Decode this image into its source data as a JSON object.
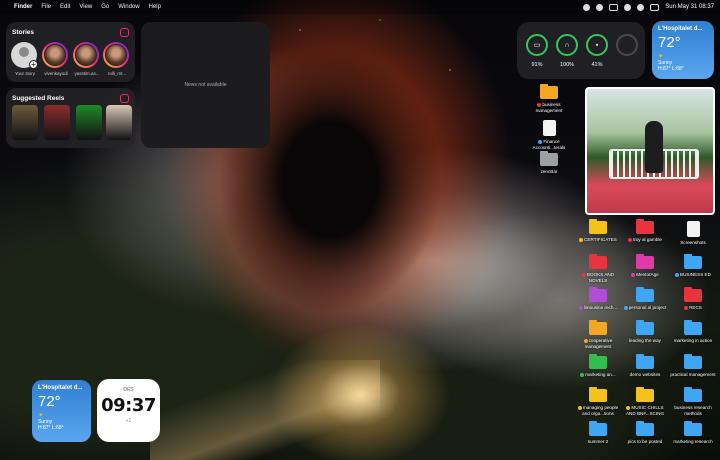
{
  "menubar": {
    "apple_glyph": "",
    "app_name": "Finder",
    "items": [
      "File",
      "Edit",
      "View",
      "Go",
      "Window",
      "Help"
    ],
    "datetime": "Sun May 31 08:37"
  },
  "stories_widget": {
    "title": "Stories",
    "stories": [
      {
        "label": "Your story"
      },
      {
        "label": "vivenkayodi"
      },
      {
        "label": "yasstim.as..."
      },
      {
        "label": "rolli_mt..."
      }
    ]
  },
  "reels_widget": {
    "title": "Suggested Reels",
    "reels": [
      {
        "color": "#6b5a3e"
      },
      {
        "color": "#8a2e2e"
      },
      {
        "color": "#1f8a2a"
      },
      {
        "color": "#d9c9b8"
      }
    ]
  },
  "news_widget": {
    "message": "News not available"
  },
  "battery_widget": {
    "items": [
      {
        "icon": "laptop-icon",
        "percent": "91%",
        "level": 0.91
      },
      {
        "icon": "airpods-icon",
        "percent": "100%",
        "level": 1.0
      },
      {
        "icon": "airpods-case-icon",
        "percent": "41%",
        "level": 0.41
      },
      {
        "icon": "empty-slot",
        "percent": "",
        "level": 0
      }
    ]
  },
  "weather_top": {
    "city": "L'Hospitalet d...",
    "temp": "72°",
    "condition": "Sunny",
    "hilo": "H:87° L:68°"
  },
  "weather_bottom": {
    "city": "L'Hospitalet d...",
    "temp": "72°",
    "condition": "Sunny",
    "hilo": "H:87° L:68°"
  },
  "clock_widget": {
    "day": "DES",
    "time": "09:37",
    "offset": "+1"
  },
  "desktop": {
    "top_items": [
      {
        "label": "business management",
        "color": "orange",
        "tag": "#e8343f"
      },
      {
        "label": "Finance Accounti...terals",
        "color": "doc",
        "tag": "#3fa5f5"
      },
      {
        "label": "zencBar",
        "color": "gray",
        "tag": ""
      }
    ],
    "grid": [
      [
        {
          "label": "CERTIFICATES",
          "color": "yellow",
          "tag": "#f4c21a"
        },
        {
          "label": "troy al gamble",
          "color": "red",
          "tag": "#e8343f"
        },
        {
          "label": "Screenshots",
          "color": "doc",
          "tag": ""
        }
      ],
      [
        {
          "label": "BOOKS AND NOVELS",
          "color": "red",
          "tag": "#e8343f"
        },
        {
          "label": "MentorAge",
          "color": "pink",
          "tag": "#e03aa8"
        },
        {
          "label": "BUSINESS ED",
          "color": "blue",
          "tag": "#3fa5f5"
        }
      ],
      [
        {
          "label": "limousine rech...",
          "color": "purple",
          "tag": "#b14cd4"
        },
        {
          "label": "personal al project",
          "color": "blue",
          "tag": "#3fa5f5"
        },
        {
          "label": "RECS",
          "color": "red",
          "tag": "#e8343f"
        }
      ],
      [
        {
          "label": "cooperative management",
          "color": "orange",
          "tag": "#f5a623"
        },
        {
          "label": "leading the way",
          "color": "blue",
          "tag": ""
        },
        {
          "label": "marketing in action",
          "color": "blue",
          "tag": ""
        }
      ],
      [
        {
          "label": "marketing an...",
          "color": "green",
          "tag": "#2fbf4f"
        },
        {
          "label": "demo websites",
          "color": "blue",
          "tag": ""
        },
        {
          "label": "practical management",
          "color": "blue",
          "tag": ""
        }
      ],
      [
        {
          "label": "managing people and orga...tions",
          "color": "yellow",
          "tag": "#f4c21a"
        },
        {
          "label": "MUSIC CHILLS AND BNF...SCING",
          "color": "yellow",
          "tag": "#f4c21a"
        },
        {
          "label": "business research methods",
          "color": "blue",
          "tag": ""
        }
      ],
      [
        {
          "label": "summer 2",
          "color": "blue",
          "tag": ""
        },
        {
          "label": "pics to be posted",
          "color": "blue",
          "tag": ""
        },
        {
          "label": "marketing research",
          "color": "blue",
          "tag": ""
        }
      ]
    ]
  }
}
